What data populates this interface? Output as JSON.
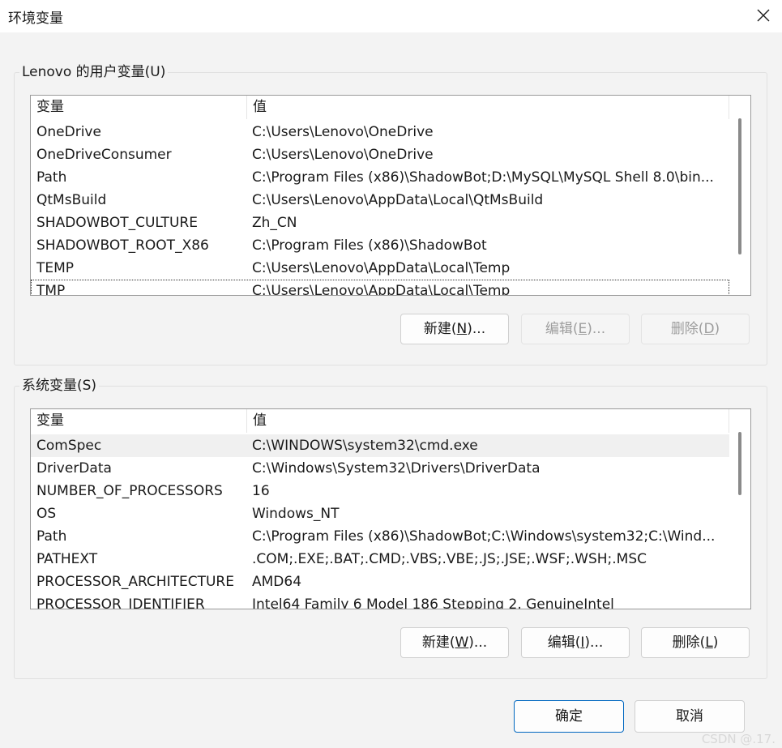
{
  "window": {
    "title": "环境变量",
    "close_label": "✕"
  },
  "user_vars": {
    "group_label": "Lenovo 的用户变量(U)",
    "header": {
      "name": "变量",
      "value": "值"
    },
    "rows": [
      {
        "name": "OneDrive",
        "value": "C:\\Users\\Lenovo\\OneDrive"
      },
      {
        "name": "OneDriveConsumer",
        "value": "C:\\Users\\Lenovo\\OneDrive"
      },
      {
        "name": "Path",
        "value": "C:\\Program Files (x86)\\ShadowBot;D:\\MySQL\\MySQL Shell 8.0\\bin..."
      },
      {
        "name": "QtMsBuild",
        "value": "C:\\Users\\Lenovo\\AppData\\Local\\QtMsBuild"
      },
      {
        "name": "SHADOWBOT_CULTURE",
        "value": "Zh_CN"
      },
      {
        "name": "SHADOWBOT_ROOT_X86",
        "value": "C:\\Program Files (x86)\\ShadowBot"
      },
      {
        "name": "TEMP",
        "value": "C:\\Users\\Lenovo\\AppData\\Local\\Temp"
      },
      {
        "name": "TMP",
        "value": "C:\\Users\\Lenovo\\AppData\\Local\\Temp"
      }
    ],
    "buttons": {
      "new_pre": "新建(",
      "new_key": "N",
      "new_post": ")...",
      "edit_pre": "编辑(",
      "edit_key": "E",
      "edit_post": ")...",
      "delete_pre": "删除(",
      "delete_key": "D",
      "delete_post": ")"
    }
  },
  "system_vars": {
    "group_label": "系统变量(S)",
    "header": {
      "name": "变量",
      "value": "值"
    },
    "rows": [
      {
        "name": "ComSpec",
        "value": "C:\\WINDOWS\\system32\\cmd.exe"
      },
      {
        "name": "DriverData",
        "value": "C:\\Windows\\System32\\Drivers\\DriverData"
      },
      {
        "name": "NUMBER_OF_PROCESSORS",
        "value": "16"
      },
      {
        "name": "OS",
        "value": "Windows_NT"
      },
      {
        "name": "Path",
        "value": "C:\\Program Files (x86)\\ShadowBot;C:\\Windows\\system32;C:\\Wind..."
      },
      {
        "name": "PATHEXT",
        "value": ".COM;.EXE;.BAT;.CMD;.VBS;.VBE;.JS;.JSE;.WSF;.WSH;.MSC"
      },
      {
        "name": "PROCESSOR_ARCHITECTURE",
        "value": "AMD64"
      },
      {
        "name": "PROCESSOR_IDENTIFIER",
        "value": "Intel64 Family 6 Model 186 Stepping 2, GenuineIntel"
      }
    ],
    "buttons": {
      "new_pre": "新建(",
      "new_key": "W",
      "new_post": ")...",
      "edit_pre": "编辑(",
      "edit_key": "I",
      "edit_post": ")...",
      "delete_pre": "删除(",
      "delete_key": "L",
      "delete_post": ")"
    }
  },
  "footer": {
    "ok_label": "确定",
    "cancel_label": "取消"
  },
  "watermark": "CSDN @.17.",
  "colors": {
    "background": "#f3f3f3",
    "selection": "#f0f0f0",
    "primary_border": "#0067c0"
  }
}
